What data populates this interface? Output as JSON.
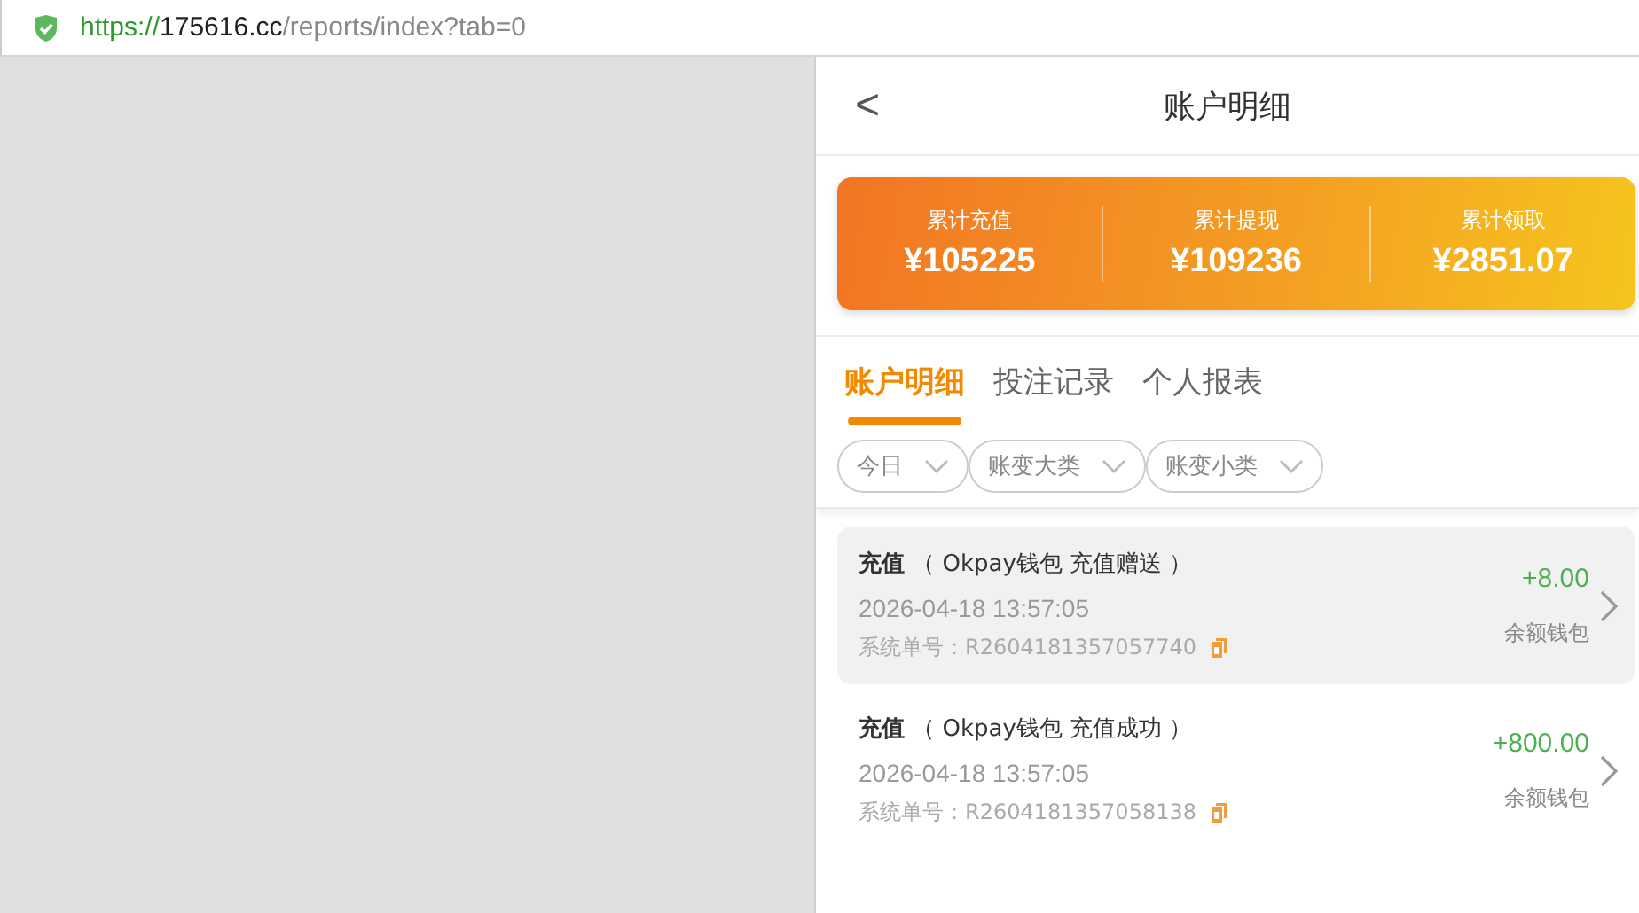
{
  "address_bar": {
    "secure": true,
    "scheme": "https://",
    "host": "175616.cc",
    "path": "/reports/index?tab=0"
  },
  "header": {
    "back": "<",
    "title": "账户明细"
  },
  "summary": [
    {
      "label": "累计充值",
      "value": "¥105225"
    },
    {
      "label": "累计提现",
      "value": "¥109236"
    },
    {
      "label": "累计领取",
      "value": "¥2851.07"
    }
  ],
  "tabs": [
    {
      "label": "账户明细",
      "selected": true
    },
    {
      "label": "投注记录",
      "selected": false
    },
    {
      "label": "个人报表",
      "selected": false
    }
  ],
  "filters": [
    {
      "label": "今日"
    },
    {
      "label": "账变大类"
    },
    {
      "label": "账变小类"
    }
  ],
  "records": [
    {
      "title": "**充值** （ Okpay钱包 充值赠送 ）",
      "time": "2026-04-18 13:57:05",
      "order": "系统单号：R2604181357057740",
      "amount": "+8.00",
      "wallet": "余额钱包",
      "selected": true
    },
    {
      "title": "**充值** （ Okpay钱包 充值成功 ）",
      "time": "2026-04-18 13:57:05",
      "order": "系统单号：R2604181357058138",
      "amount": "+800.00",
      "wallet": "余额钱包",
      "selected": false
    }
  ]
}
